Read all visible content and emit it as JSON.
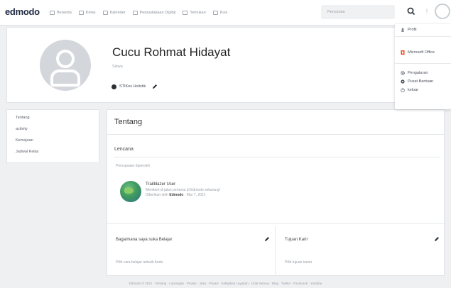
{
  "topbar": {
    "logo": "edmodo",
    "nav": [
      {
        "icon": "home-icon",
        "label": "Beranda"
      },
      {
        "icon": "class-icon",
        "label": "Kelas"
      },
      {
        "icon": "calendar-icon",
        "label": "Kalender"
      },
      {
        "icon": "library-icon",
        "label": "Perpustakaan Digital"
      },
      {
        "icon": "discover-icon",
        "label": "Temukan"
      },
      {
        "icon": "grid-icon",
        "label": "Kuis"
      }
    ],
    "search_placeholder": "Pencarian",
    "apps_icon": "apps-grid-icon",
    "search_icon": "search-icon"
  },
  "dropdown": {
    "items": [
      {
        "icon": "user-icon",
        "label": "Profil"
      },
      {
        "icon": "office-icon",
        "label": "Microsoft Office"
      },
      {
        "icon": "gear-icon",
        "label": "Pengaturan"
      },
      {
        "icon": "help-icon",
        "label": "Pusat Bantuan"
      },
      {
        "icon": "logout-icon",
        "label": "keluar"
      }
    ],
    "colors": {
      "office": "#e74c22",
      "text": "#4a5058"
    }
  },
  "profile": {
    "name": "Cucu Rohmat Hidayat",
    "role": "Siswa",
    "school": "STIKes Holistik"
  },
  "sidebar": {
    "items": [
      {
        "label": "Tentang"
      },
      {
        "label": "activity"
      },
      {
        "label": "Kemajuan"
      },
      {
        "label": "Jadwal Kelas"
      }
    ]
  },
  "main": {
    "title": "Tentang",
    "badges_title": "Lencana",
    "badges_sub": "Pencapaian diperoleh",
    "badge": {
      "title": "Trailblazer User",
      "desc": "Memberi di jalan pertama di Edmodo sekarang!",
      "by_prefix": "Diberikan oleh",
      "by_name": "Edmodo",
      "by_date": "· Mar 7, 2021"
    },
    "left_col": {
      "title": "Bagaimana saya suka Belajar",
      "sub": "Pilih cara belajar terbaik Anda"
    },
    "right_col": {
      "title": "Tujuan Karir",
      "sub": "Pilih tujuan karier"
    }
  },
  "footer": "Edmodo © 2021 · Tentang · Lowongan · Privasi · Jasa · Privasi · Kebijakan Layanan · Lihat Semua · Blog · Twitter · Facebook · Youtube"
}
